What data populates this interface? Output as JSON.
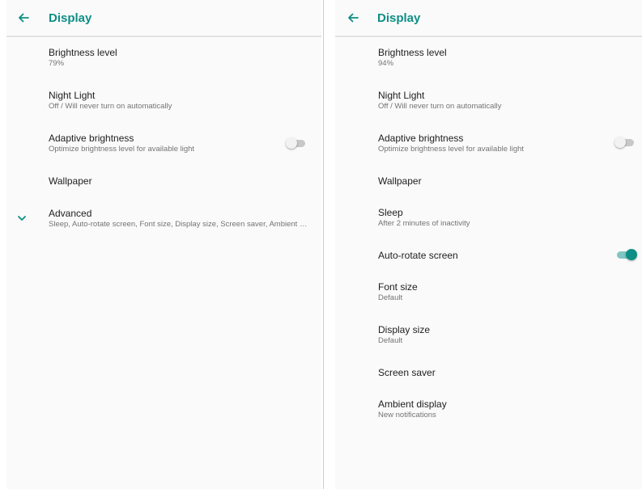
{
  "accent_color": "#0e8f86",
  "left_panel": {
    "title": "Display",
    "back_icon": "arrow-back-icon",
    "items": [
      {
        "title": "Brightness level",
        "subtitle": "79%"
      },
      {
        "title": "Night Light",
        "subtitle": "Off / Will never turn on automatically"
      },
      {
        "title": "Adaptive brightness",
        "subtitle": "Optimize brightness level for available light",
        "toggle": false
      },
      {
        "title": "Wallpaper"
      },
      {
        "title": "Advanced",
        "subtitle": "Sleep, Auto-rotate screen, Font size, Display size, Screen saver, Ambient display",
        "icon": "chevron-down-icon"
      }
    ]
  },
  "right_panel": {
    "title": "Display",
    "back_icon": "arrow-back-icon",
    "items": [
      {
        "title": "Brightness level",
        "subtitle": "94%"
      },
      {
        "title": "Night Light",
        "subtitle": "Off / Will never turn on automatically"
      },
      {
        "title": "Adaptive brightness",
        "subtitle": "Optimize brightness level for available light",
        "toggle": false
      },
      {
        "title": "Wallpaper"
      },
      {
        "title": "Sleep",
        "subtitle": "After 2 minutes of inactivity"
      },
      {
        "title": "Auto-rotate screen",
        "toggle": true
      },
      {
        "title": "Font size",
        "subtitle": "Default"
      },
      {
        "title": "Display size",
        "subtitle": "Default"
      },
      {
        "title": "Screen saver"
      },
      {
        "title": "Ambient display",
        "subtitle": "New notifications"
      }
    ]
  }
}
